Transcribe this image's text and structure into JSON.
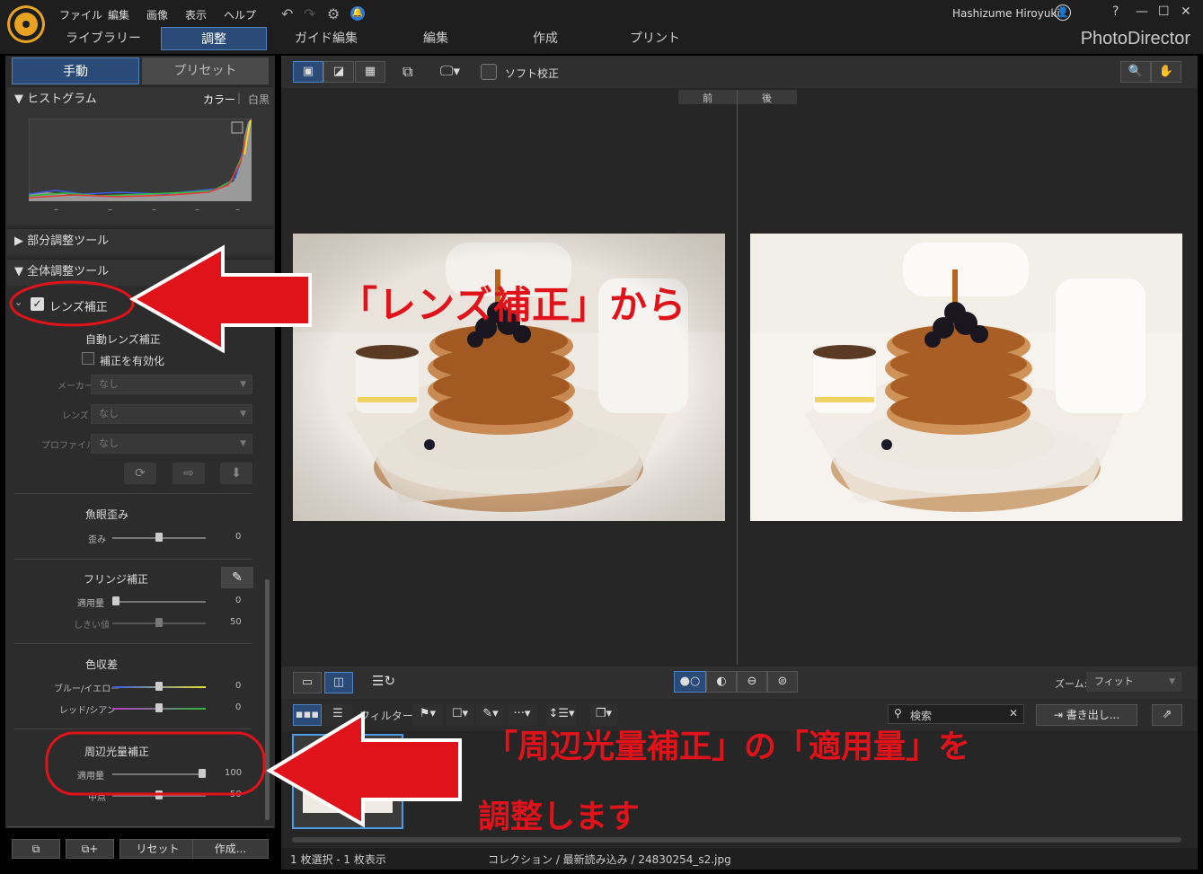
{
  "menu": {
    "file": "ファイル",
    "edit": "編集",
    "image": "画像",
    "view": "表示",
    "help": "ヘルプ"
  },
  "user": {
    "name": "Hashizume Hiroyuki"
  },
  "window": {
    "help": "?"
  },
  "tabs": [
    {
      "label": "ライブラリー"
    },
    {
      "label": "調整"
    },
    {
      "label": "ガイド編集"
    },
    {
      "label": "編集"
    },
    {
      "label": "作成"
    },
    {
      "label": "プリント"
    }
  ],
  "brand": "PhotoDirector",
  "panel": {
    "tab_manual": "手動",
    "tab_preset": "プリセット",
    "histogram": {
      "title": "ヒストグラム",
      "color": "カラー",
      "sep": "|",
      "mono": "白黒",
      "values": [
        "–",
        "–",
        "–",
        "–",
        "–"
      ]
    },
    "partial_tools": "部分調整ツール",
    "global_tools": "全体調整ツール",
    "lens": {
      "title": "レンズ補正",
      "auto_title": "自動レンズ補正",
      "enable": "補正を有効化",
      "maker_label": "メーカー",
      "maker_value": "なし",
      "lens_label": "レンズ",
      "lens_value": "なし",
      "profile_label": "プロファイル",
      "profile_value": "なし"
    },
    "fisheye": {
      "title": "魚眼歪み",
      "label": "歪み",
      "value": "0",
      "level": 0.5
    },
    "fringe": {
      "title": "フリンジ補正",
      "amount_label": "適用量",
      "amount_value": "0",
      "amount_level": 0.0,
      "threshold_label": "しきい値",
      "threshold_value": "50",
      "threshold_level": 0.5
    },
    "chroma": {
      "title": "色収差",
      "blue_label": "ブルー/イエロー",
      "blue_value": "0",
      "blue_level": 0.5,
      "red_label": "レッド/シアン",
      "red_value": "0",
      "red_level": 0.5
    },
    "vignette": {
      "title": "周辺光量補正",
      "amount_label": "適用量",
      "amount_value": "100",
      "amount_level": 1.0,
      "mid_label": "中点",
      "mid_value": "50",
      "mid_level": 0.5
    },
    "buttons": {
      "reset": "リセット",
      "create": "作成..."
    }
  },
  "viewer": {
    "soft_proof": "ソフト校正",
    "before": "前",
    "after": "後",
    "zoom_label": "ズーム:",
    "zoom_value": "フィット"
  },
  "filmbar": {
    "filter_label": "フィルター:",
    "search_placeholder": "検索",
    "export": "書き出し..."
  },
  "status": {
    "selection": "1 枚選択 - 1 枚表示",
    "path": "コレクション / 最新読み込み / 24830254_s2.jpg"
  },
  "annotations": {
    "lens_callout": "「レンズ補正」から",
    "vignette_callout_1": "「周辺光量補正」の「適用量」を",
    "vignette_callout_2": "調整します"
  },
  "colors": {
    "accent": "#2a4a78",
    "annotation_red": "#e0131b",
    "logo": "#e9a323"
  }
}
